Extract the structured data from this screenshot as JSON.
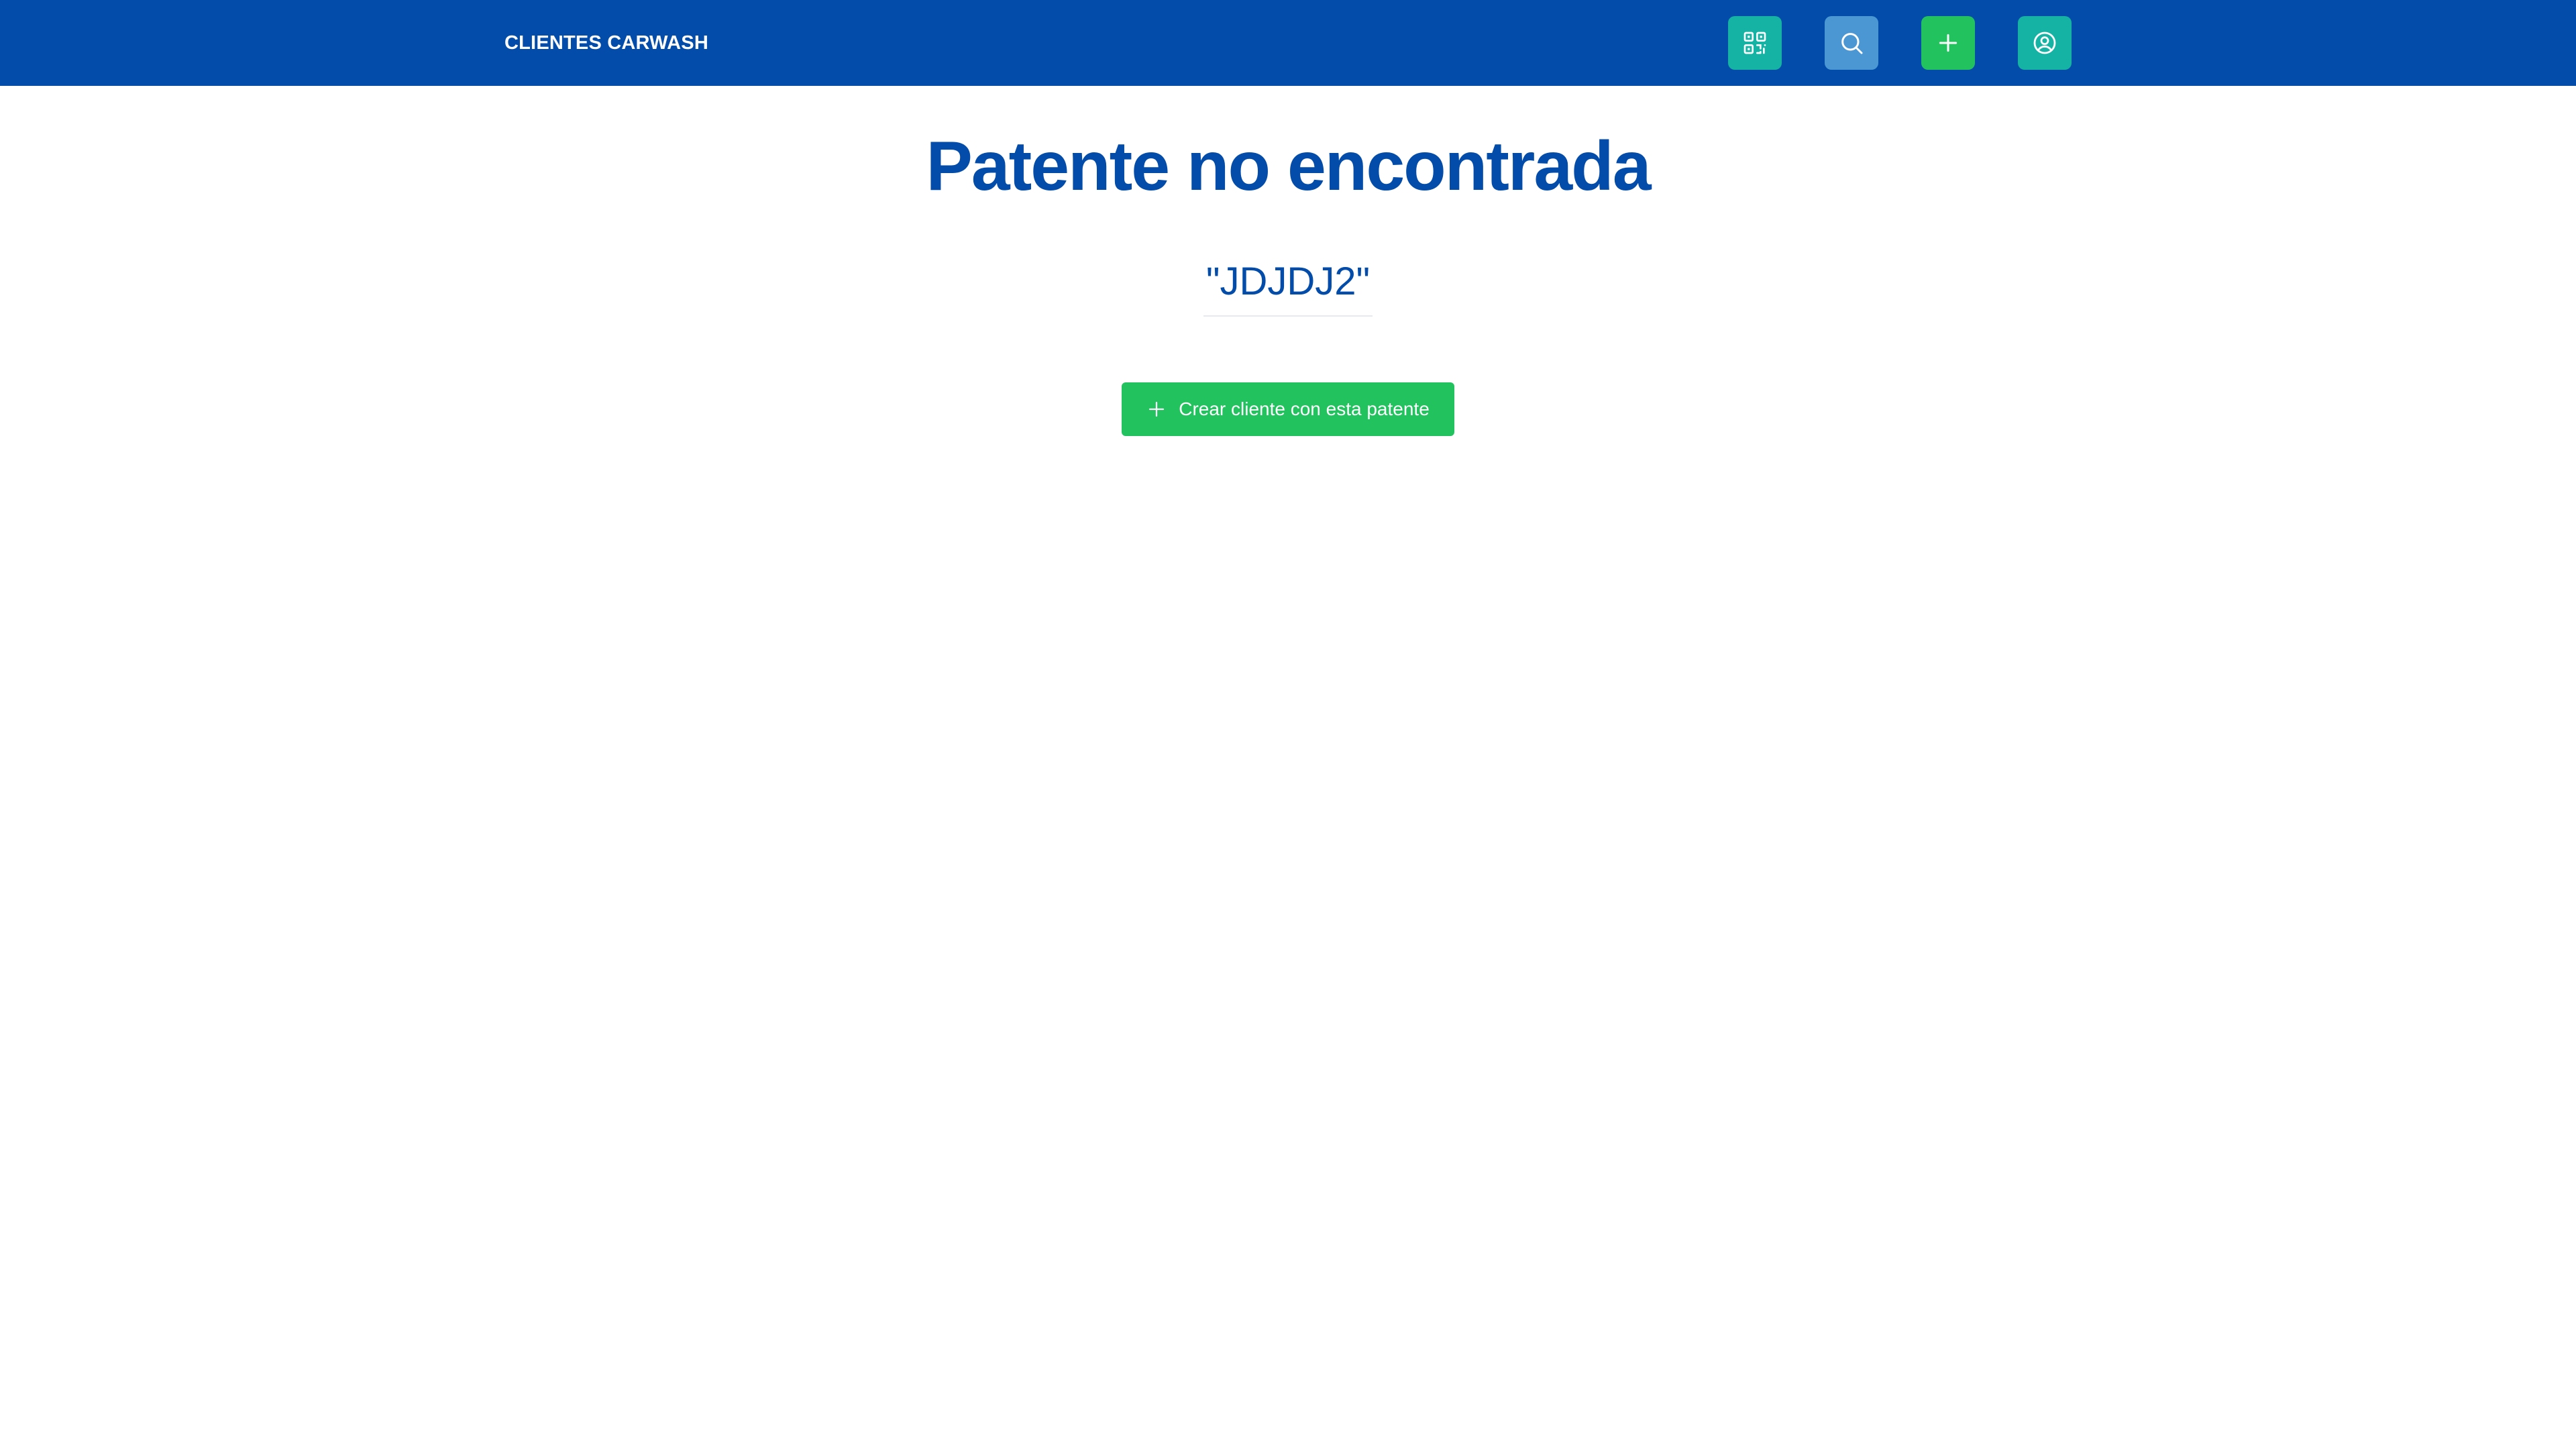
{
  "header": {
    "brand": "CLIENTES CARWASH",
    "buttons": [
      {
        "name": "qr",
        "icon": "qr-code-icon",
        "color": "#14b3a4"
      },
      {
        "name": "search",
        "icon": "search-icon",
        "color": "#4b97d4"
      },
      {
        "name": "add",
        "icon": "plus-icon",
        "color": "#22c35e"
      },
      {
        "name": "user",
        "icon": "user-circle-icon",
        "color": "#14b3a4"
      }
    ],
    "background": "#034ca9"
  },
  "main": {
    "title": "Patente no encontrada",
    "plate": "\"JDJDJ2\"",
    "create_button_label": "Crear cliente con esta patente",
    "create_button_icon": "plus-icon"
  },
  "colors": {
    "primary": "#034ca9",
    "success": "#22c35e",
    "teal": "#14b3a4",
    "light_blue": "#4b97d4"
  }
}
